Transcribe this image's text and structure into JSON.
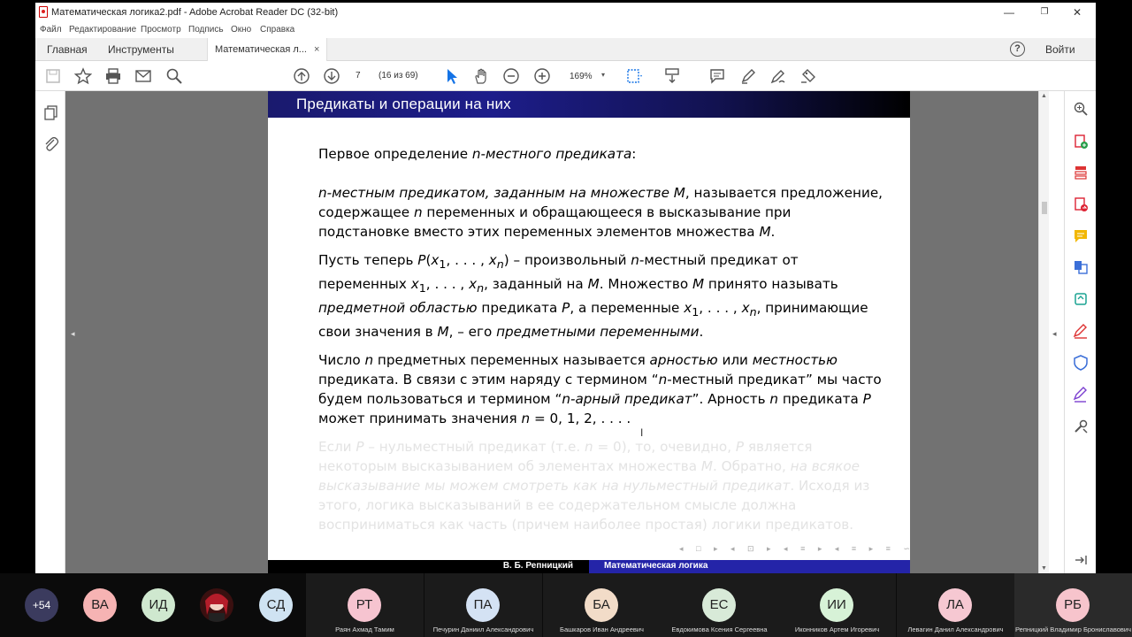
{
  "titlebar": {
    "title": "Математическая логика2.pdf - Adobe Acrobat Reader DC (32-bit)",
    "minimize": "—",
    "restore": "❐",
    "close": "✕"
  },
  "menu": [
    "Файл",
    "Редактирование",
    "Просмотр",
    "Подпись",
    "Окно",
    "Справка"
  ],
  "tabs": {
    "home": "Главная",
    "tools": "Инструменты",
    "document": "Математическая л...",
    "close_symbol": "×",
    "help_symbol": "?",
    "login": "Войти"
  },
  "toolbar": {
    "page_number": "7",
    "page_count": "(16 из 69)",
    "zoom": "169%",
    "icons": [
      "save-icon",
      "star-icon",
      "print-icon",
      "mail-icon",
      "search-icon",
      "prev-page-icon",
      "next-page-icon",
      "select-cursor-icon",
      "hand-icon",
      "zoom-out-icon",
      "zoom-in-icon",
      "fit-page-icon",
      "scroll-mode-icon",
      "comment-icon",
      "highlight-pen-icon",
      "sign-icon",
      "share-icon"
    ]
  },
  "right_tools": [
    "zoom-search-icon",
    "create-pdf-icon",
    "organize-pages-icon",
    "export-pdf-icon",
    "comment-icon",
    "combine-files-icon",
    "compress-icon",
    "fill-sign-icon",
    "protect-icon",
    "edit-sign-icon",
    "more-tools-icon"
  ],
  "slide": {
    "header": "Предикаты и операции на них",
    "footer_author": "В. Б. Репницкий",
    "footer_title": "Математическая логика",
    "nav_symbols": "◂ □ ▸ ◂ ⊡ ▸ ◂ ≡ ▸ ◂ ≡ ▸ ≡ ∽∾∿"
  },
  "participants": [
    {
      "initials": "+54",
      "name": "",
      "color": "#3b3b5e"
    },
    {
      "initials": "ВА",
      "name": "",
      "color": "#f6b3b3"
    },
    {
      "initials": "ИД",
      "name": "",
      "color": "#cfe8cf"
    },
    {
      "initials": "",
      "name": "",
      "color": "#7a1e1e"
    },
    {
      "initials": "СД",
      "name": "",
      "color": "#cfe3f2"
    },
    {
      "initials": "РТ",
      "name": "Раян Ахмад Тамим",
      "color": "#f6c4d0"
    },
    {
      "initials": "ПА",
      "name": "Печурин Даниил Александрович",
      "color": "#d4e2f4"
    },
    {
      "initials": "БА",
      "name": "Башкаров Иван Андреевич",
      "color": "#f2dcc8"
    },
    {
      "initials": "ЕС",
      "name": "Евдокимова Ксения Сергеевна",
      "color": "#d8ead8"
    },
    {
      "initials": "ИИ",
      "name": "Иконников Артем Игоревич",
      "color": "#d7f2d7"
    },
    {
      "initials": "ЛА",
      "name": "Левагин Данил Александрович",
      "color": "#f6c8d2"
    },
    {
      "initials": "РБ",
      "name": "Репницкий Владимир Брониславович",
      "color": "#f7c4cc"
    }
  ]
}
